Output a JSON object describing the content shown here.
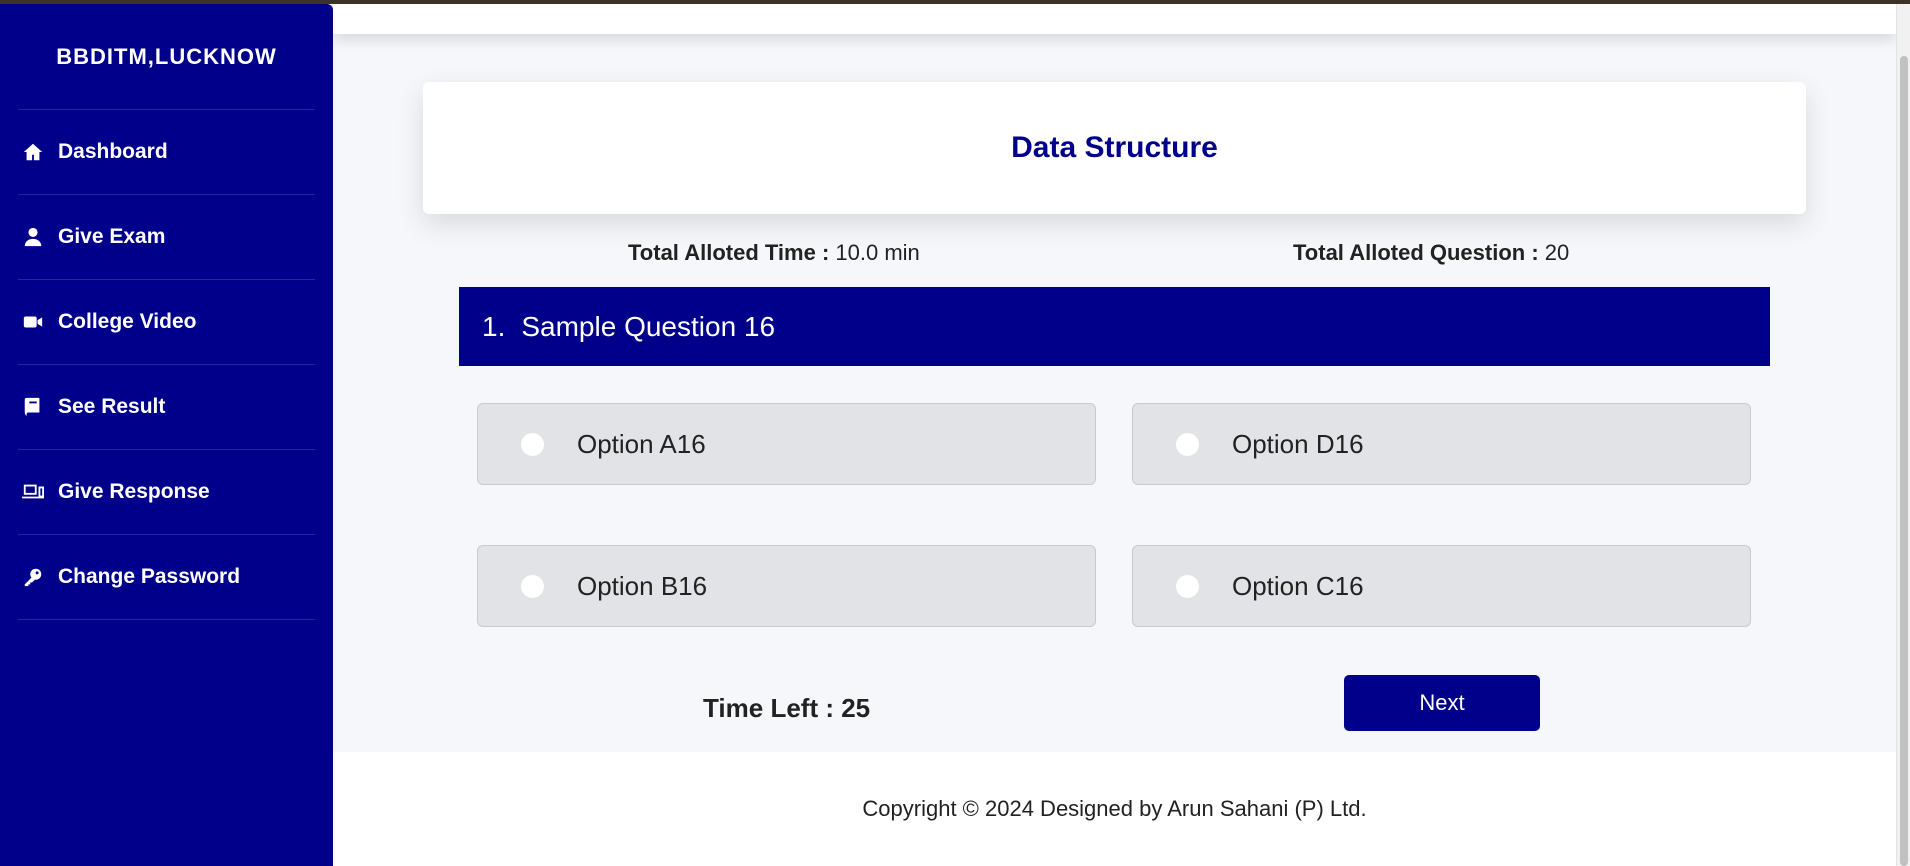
{
  "sidebar": {
    "brand": "BBDITM,LUCKNOW",
    "items": [
      {
        "label": "Dashboard",
        "icon": "home-icon"
      },
      {
        "label": "Give Exam",
        "icon": "user-icon"
      },
      {
        "label": "College Video",
        "icon": "video-camera-icon"
      },
      {
        "label": "See Result",
        "icon": "book-icon"
      },
      {
        "label": "Give Response",
        "icon": "devices-icon"
      },
      {
        "label": "Change Password",
        "icon": "key-icon"
      }
    ]
  },
  "exam": {
    "title": "Data Structure",
    "time_label": "Total Alloted Time :",
    "time_value": "10.0 min",
    "question_count_label": "Total Alloted Question :",
    "question_count_value": "20",
    "question_number": "1.",
    "question_text": "Sample Question 16",
    "options": [
      "Option A16",
      "Option D16",
      "Option B16",
      "Option C16"
    ],
    "timer_label": "Time Left : 25",
    "next_label": "Next"
  },
  "footer": {
    "copyright": "Copyright © 2024 Designed by Arun Sahani (P) Ltd."
  },
  "colors": {
    "primary": "#00008b",
    "option_bg": "#e2e3e6",
    "page_bg": "#f6f7fb"
  }
}
